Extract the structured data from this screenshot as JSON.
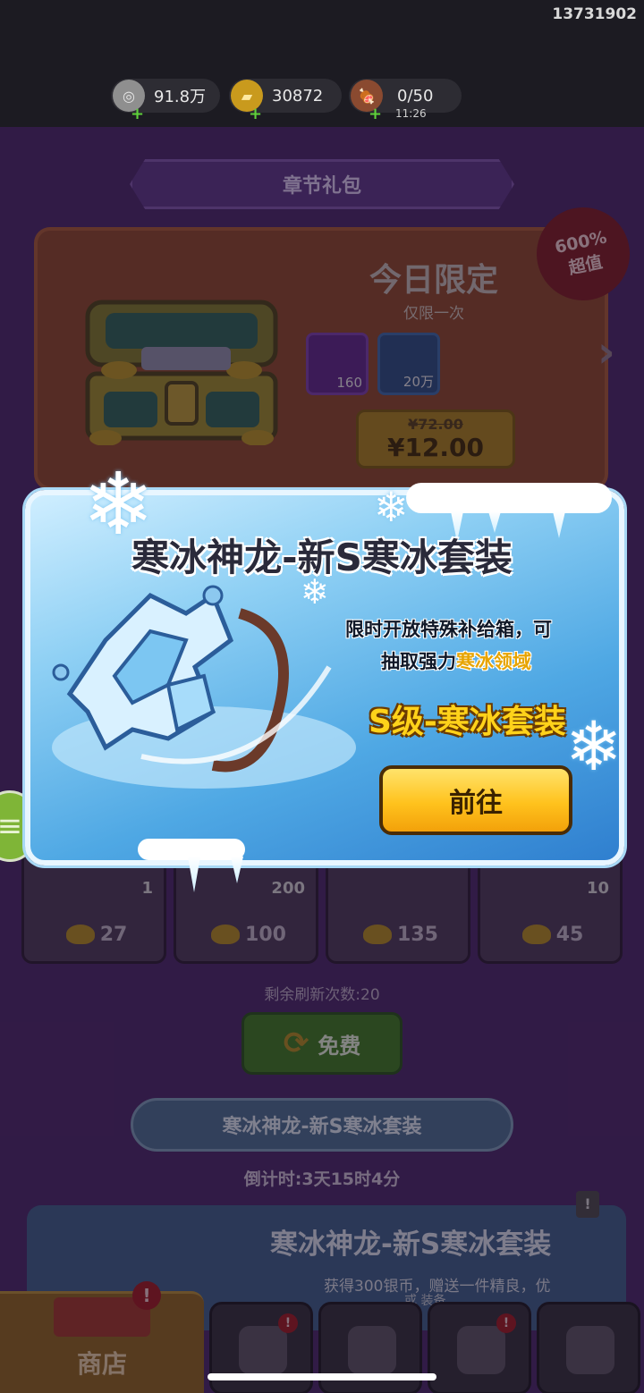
{
  "status": {
    "uid": "13731902",
    "resources": [
      {
        "name": "silver",
        "icon": "silver-coin-icon",
        "value": "91.8万"
      },
      {
        "name": "gold",
        "icon": "gold-ingot-icon",
        "value": "30872"
      },
      {
        "name": "stamina",
        "icon": "meat-icon",
        "value": "0/50"
      }
    ],
    "stamina_timer": "11:26"
  },
  "chapter_gift": {
    "banner": "章节礼包",
    "badge_line1": "600%",
    "badge_line2": "超值",
    "title": "今日限定",
    "subtitle": "仅限一次",
    "rewards": [
      {
        "icon": "gold-ingot-icon",
        "amount": "160"
      },
      {
        "icon": "silver-coin-icon",
        "amount": "20万"
      }
    ],
    "old_price": "¥72.00",
    "price": "¥12.00"
  },
  "shop": {
    "items": [
      {
        "qty": "1",
        "cost": "27"
      },
      {
        "qty": "200",
        "cost": "100"
      },
      {
        "qty": "",
        "cost": "135"
      },
      {
        "qty": "10",
        "cost": "45"
      }
    ],
    "refresh_text": "剩余刷新次数:20",
    "free_label": "免费"
  },
  "event": {
    "banner": "寒冰神龙-新S寒冰套装",
    "countdown": "倒计时:3天15时4分",
    "title": "寒冰神龙-新S寒冰套装",
    "desc_line1": "获得300银币，赠送一件精良，优",
    "desc_line2": "或 装备"
  },
  "nav": {
    "shop_label": "商店",
    "alert": "!"
  },
  "popup": {
    "title": "寒冰神龙-新S寒冰套装",
    "desc_line1": "限时开放特殊补给箱，可",
    "desc_line2_prefix": "抽取强力",
    "desc_line2_highlight": "寒冰领域",
    "tier": "S级-寒冰套装",
    "go_label": "前往"
  },
  "colors": {
    "popup_gradient_top": "#cfeeff",
    "popup_gradient_bottom": "#2f7fcf",
    "go_button": "#ffc21d",
    "tier_text": "#ffd21a",
    "highlight_text": "#e7a400"
  }
}
